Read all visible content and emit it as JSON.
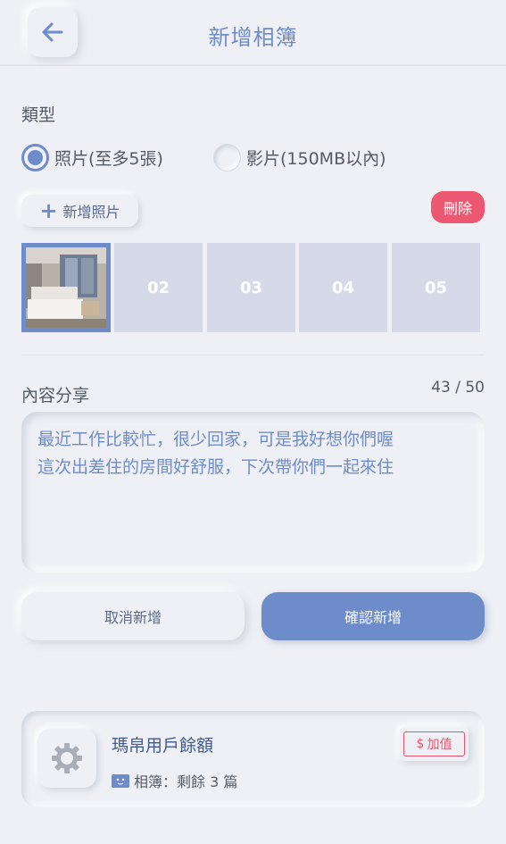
{
  "header": {
    "title": "新增相簿"
  },
  "type_section": {
    "label": "類型",
    "options": [
      {
        "label": "照片(至多5張)",
        "selected": true
      },
      {
        "label": "影片(150MB以內)",
        "selected": false
      }
    ]
  },
  "photos": {
    "add_label": "新增照片",
    "delete_label": "刪除",
    "slots": [
      "",
      "02",
      "03",
      "04",
      "05"
    ]
  },
  "content": {
    "label": "內容分享",
    "counter": "43 / 50",
    "text_line1": "最近工作比較忙，很少回家，可是我好想你們喔",
    "text_line2": "這次出差住的房間好舒服，下次帶你們一起來住"
  },
  "actions": {
    "cancel_label": "取消新增",
    "confirm_label": "確認新增"
  },
  "balance": {
    "title": "瑪帛用戶餘額",
    "topup_label": "加值",
    "album_label": "相簿：剩餘 3 篇"
  },
  "colors": {
    "accent": "#6d8cc9",
    "danger": "#ec5771",
    "background": "#eef0f5"
  }
}
